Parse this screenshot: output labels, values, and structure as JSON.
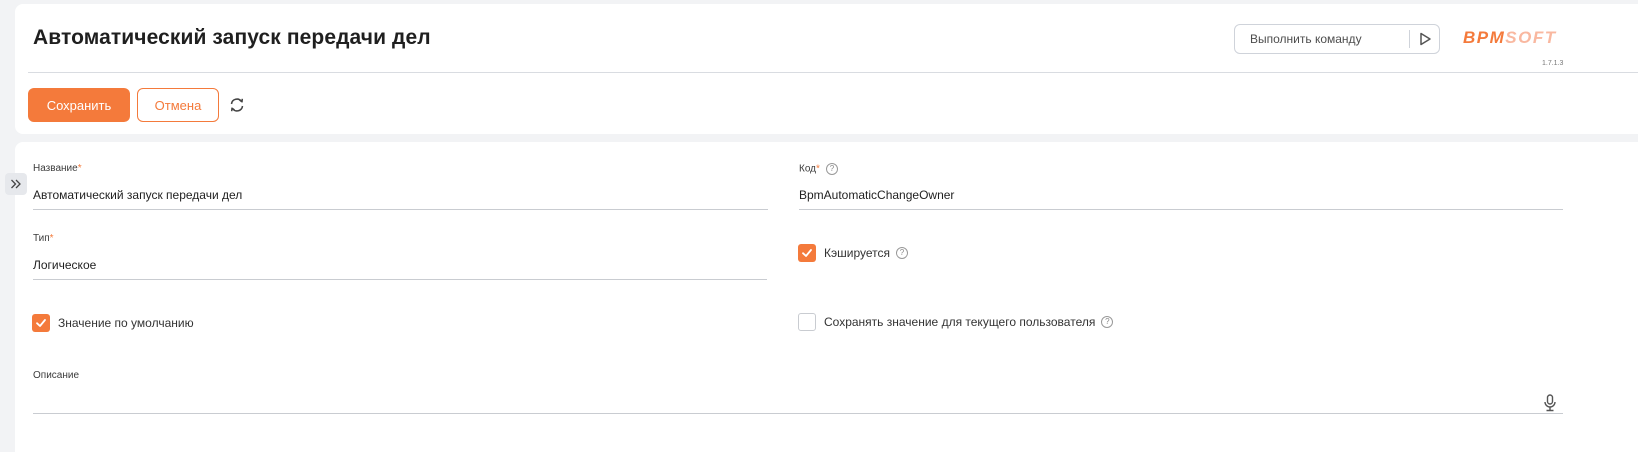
{
  "header": {
    "title": "Автоматический запуск передачи дел",
    "command_placeholder": "Выполнить команду",
    "logo_part1": "BPM",
    "logo_part2": "SOFT",
    "version": "1.7.1.3"
  },
  "toolbar": {
    "save_label": "Сохранить",
    "cancel_label": "Отмена"
  },
  "form": {
    "name": {
      "label": "Название",
      "required": "*",
      "value": "Автоматический запуск передачи дел"
    },
    "code": {
      "label": "Код",
      "required": "*",
      "help": "?",
      "value": "BpmAutomaticChangeOwner"
    },
    "type": {
      "label": "Тип",
      "required": "*",
      "value": "Логическое"
    },
    "cached": {
      "label": "Кэшируется",
      "help": "?",
      "checked": true
    },
    "default_value": {
      "label": "Значение по умолчанию",
      "checked": true
    },
    "save_for_user": {
      "label": "Сохранять значение для текущего пользователя",
      "help": "?",
      "checked": false
    },
    "description": {
      "label": "Описание",
      "value": ""
    }
  },
  "colors": {
    "accent": "#f47a3b",
    "background": "#f2f3f5",
    "card": "#ffffff"
  },
  "icons": {
    "run": "play-icon",
    "refresh": "refresh-icon",
    "collapse": "double-chevron-right-icon",
    "mic": "microphone-icon",
    "check": "check-icon",
    "help": "question-circle-icon"
  }
}
